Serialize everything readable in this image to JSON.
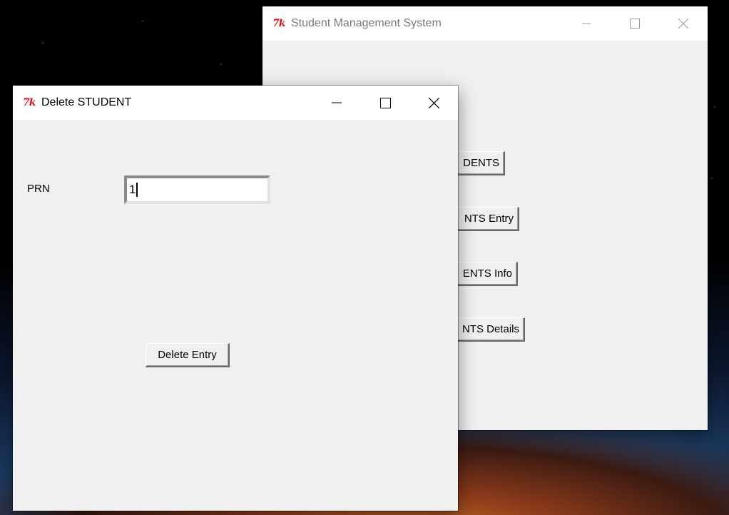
{
  "back_window": {
    "title": "Student Management System",
    "buttons": [
      {
        "label": "DENTS"
      },
      {
        "label": "NTS Entry"
      },
      {
        "label": "ENTS Info"
      },
      {
        "label": "NTS Details"
      }
    ]
  },
  "front_window": {
    "title": "Delete STUDENT",
    "prn_label": "PRN",
    "prn_value": "1",
    "delete_button_label": "Delete Entry"
  },
  "icons": {
    "app_logo": "tk-feather-logo",
    "minimize": "minimize-icon",
    "maximize": "maximize-icon",
    "close": "close-icon"
  },
  "colors": {
    "window_bg": "#f0f0f0",
    "titlebar_bg": "#ffffff",
    "tk_logo": "#e0121b",
    "inactive_title": "#7a7a7a"
  }
}
